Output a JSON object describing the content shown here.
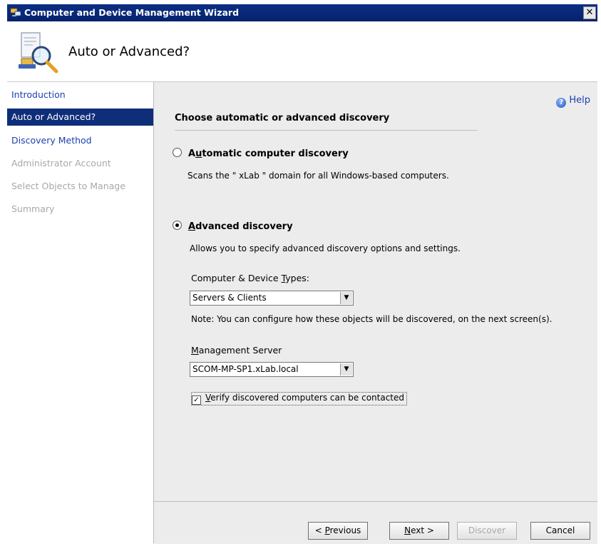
{
  "window": {
    "title": "Computer and Device Management Wizard",
    "close_glyph": "✕"
  },
  "header": {
    "heading": "Auto or Advanced?"
  },
  "sidebar": {
    "items": [
      {
        "label": "Introduction"
      },
      {
        "label": "Auto or Advanced?"
      },
      {
        "label": "Discovery Method"
      },
      {
        "label": "Administrator Account"
      },
      {
        "label": "Select Objects to Manage"
      },
      {
        "label": "Summary"
      }
    ]
  },
  "content": {
    "help_label": "Help",
    "section_title": "Choose automatic or advanced discovery",
    "auto": {
      "label_prefix": "A",
      "label_accel": "u",
      "label_rest": "tomatic computer discovery",
      "description": "Scans the \" xLab \" domain for all Windows-based computers."
    },
    "advanced": {
      "label_accel": "A",
      "label_rest": "dvanced discovery",
      "description": "Allows you to specify advanced discovery options and settings."
    },
    "device_types": {
      "label_prefix": "Computer & Device ",
      "label_accel": "T",
      "label_rest": "ypes:",
      "value": "Servers & Clients"
    },
    "note": "Note: You can configure how these objects will be discovered, on the next screen(s).",
    "management_server": {
      "label_accel": "M",
      "label_rest": "anagement Server",
      "value": "SCOM-MP-SP1.xLab.local"
    },
    "verify": {
      "label_accel": "V",
      "label_rest": "erify discovered computers can be contacted",
      "checked": true
    }
  },
  "footer": {
    "previous": {
      "prefix": "< ",
      "accel": "P",
      "rest": "revious"
    },
    "next": {
      "accel": "N",
      "rest": "ext >"
    },
    "discover": {
      "label": "Discover"
    },
    "cancel": {
      "label": "Cancel"
    }
  },
  "colors": {
    "active_step": "#0e2e7a",
    "link": "#1a3fb0",
    "panel": "#ececec",
    "title_bar": "#0b2f86"
  }
}
